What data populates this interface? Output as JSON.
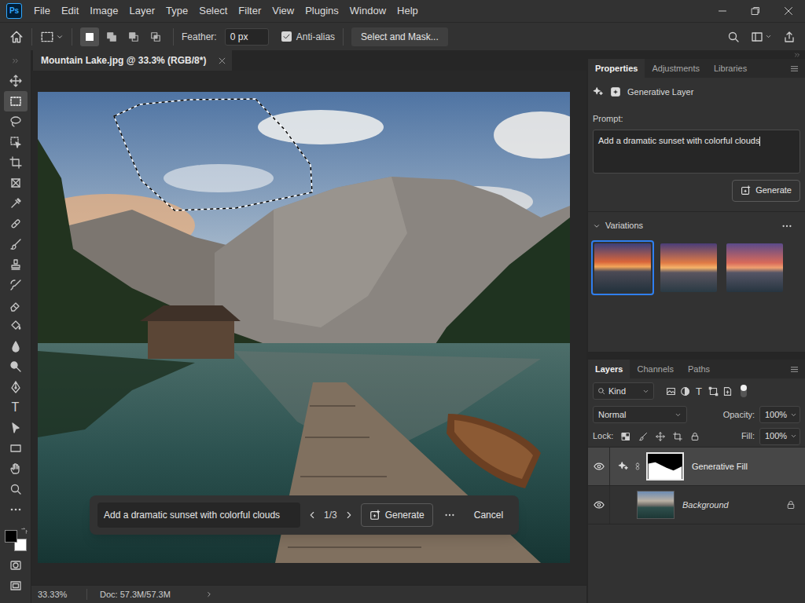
{
  "app": {
    "logo": "Ps"
  },
  "menu": [
    "File",
    "Edit",
    "Image",
    "Layer",
    "Type",
    "Select",
    "Filter",
    "View",
    "Plugins",
    "Window",
    "Help"
  ],
  "options_bar": {
    "selection_modes": [
      {
        "kind": "new",
        "selected": true
      },
      {
        "kind": "add",
        "selected": false
      },
      {
        "kind": "subtract",
        "selected": false
      },
      {
        "kind": "intersect",
        "selected": false
      }
    ],
    "feather_label": "Feather:",
    "feather_value": "0 px",
    "anti_alias": {
      "label": "Anti-alias",
      "checked": true
    },
    "select_and_mask": "Select and Mask..."
  },
  "tools": [
    {
      "kind": "move",
      "selected": false
    },
    {
      "kind": "marquee",
      "selected": true
    },
    {
      "kind": "lasso",
      "selected": false
    },
    {
      "kind": "object",
      "selected": false
    },
    {
      "kind": "crop",
      "selected": false
    },
    {
      "kind": "frame",
      "selected": false
    },
    {
      "kind": "eyedropper",
      "selected": false
    },
    {
      "kind": "healing",
      "selected": false
    },
    {
      "kind": "brush",
      "selected": false
    },
    {
      "kind": "stamp",
      "selected": false
    },
    {
      "kind": "history",
      "selected": false
    },
    {
      "kind": "eraser",
      "selected": false
    },
    {
      "kind": "bucket",
      "selected": false
    },
    {
      "kind": "blur",
      "selected": false
    },
    {
      "kind": "dodge",
      "selected": false
    },
    {
      "kind": "pen",
      "selected": false
    },
    {
      "kind": "type",
      "glyph": "T",
      "selected": false
    },
    {
      "kind": "path",
      "selected": false
    },
    {
      "kind": "shape",
      "selected": false
    },
    {
      "kind": "hand",
      "selected": false
    },
    {
      "kind": "zoom",
      "selected": false
    },
    {
      "kind": "more",
      "selected": false
    }
  ],
  "swatches": [
    {
      "color": "#000000"
    },
    {
      "color": "#ffffff"
    }
  ],
  "document": {
    "tab": "Mountain Lake.jpg @ 33.3% (RGB/8*)"
  },
  "context_bar": {
    "prompt": "Add a dramatic sunset with colorful clouds",
    "counter": "1/3",
    "generate": "Generate",
    "cancel": "Cancel"
  },
  "status_bar": {
    "zoom": "33.33%",
    "doc": "Doc: 57.3M/57.3M"
  },
  "properties": {
    "tabs": [
      {
        "label": "Properties",
        "selected": true
      },
      {
        "label": "Adjustments",
        "selected": false
      },
      {
        "label": "Libraries",
        "selected": false
      }
    ],
    "layer_type": "Generative Layer",
    "prompt_label": "Prompt:",
    "prompt": "Add a dramatic sunset with colorful clouds",
    "prompt_focused": true,
    "generate": "Generate",
    "variations": {
      "title": "Variations",
      "expanded": true,
      "items": [
        {
          "selected": true
        },
        {
          "selected": false
        },
        {
          "selected": false
        }
      ]
    }
  },
  "layers_panel": {
    "tabs": [
      {
        "label": "Layers",
        "selected": true
      },
      {
        "label": "Channels",
        "selected": false
      },
      {
        "label": "Paths",
        "selected": false
      }
    ],
    "filter_kind": "Kind",
    "filters": [
      {
        "kind": "pixel"
      },
      {
        "kind": "adjustment"
      },
      {
        "kind": "type",
        "glyph": "T"
      },
      {
        "kind": "shape"
      },
      {
        "kind": "smart"
      }
    ],
    "filter_on": true,
    "blend_mode": "Normal",
    "opacity_label": "Opacity:",
    "opacity": "100%",
    "lock_label": "Lock:",
    "fill_label": "Fill:",
    "fill": "100%",
    "layers": [
      {
        "name": "Generative Fill",
        "kind": "generative",
        "visible": true,
        "selected": true,
        "locked": false
      },
      {
        "name": "Background",
        "kind": "image",
        "visible": true,
        "selected": false,
        "locked": true
      }
    ]
  }
}
